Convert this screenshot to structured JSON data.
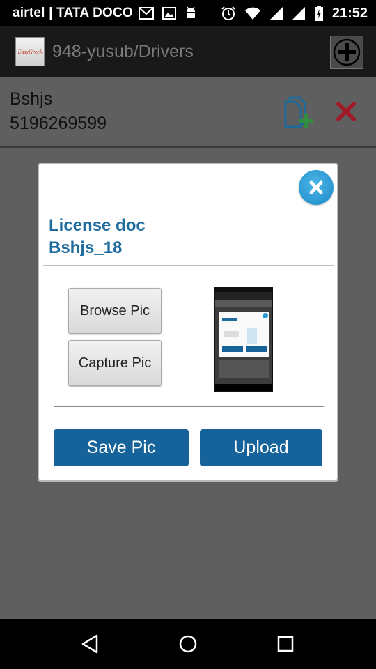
{
  "status_bar": {
    "carrier": "airtel | TATA DOCO",
    "time": "21:52",
    "icons": [
      "gmail-icon",
      "image-icon",
      "android-icon",
      "alarm-icon",
      "wifi-icon",
      "signal-icon",
      "signal-icon-2",
      "battery-charging-icon"
    ]
  },
  "app_bar": {
    "title": "948-yusub/Drivers",
    "logo_text": "EasyGreek",
    "add_icon": "plus-circle-icon"
  },
  "record": {
    "name": "Bshjs",
    "phone": "5196269599",
    "add_doc_icon": "add-document-icon",
    "delete_icon": "delete-x-icon"
  },
  "dialog": {
    "title_line1": "License doc",
    "title_line2": "Bshjs_18",
    "close_icon": "close-icon",
    "browse_label": "Browse Pic",
    "capture_label": "Capture Pic",
    "save_label": "Save Pic",
    "upload_label": "Upload"
  },
  "nav_bar": {
    "icons": [
      "back-icon",
      "home-icon",
      "recents-icon"
    ]
  },
  "colors": {
    "accent": "#15639a",
    "title": "#1f6c9e",
    "close_circle": "#2a9ad6",
    "delete": "#a11a2a",
    "add_doc": "#1e6b9a"
  }
}
